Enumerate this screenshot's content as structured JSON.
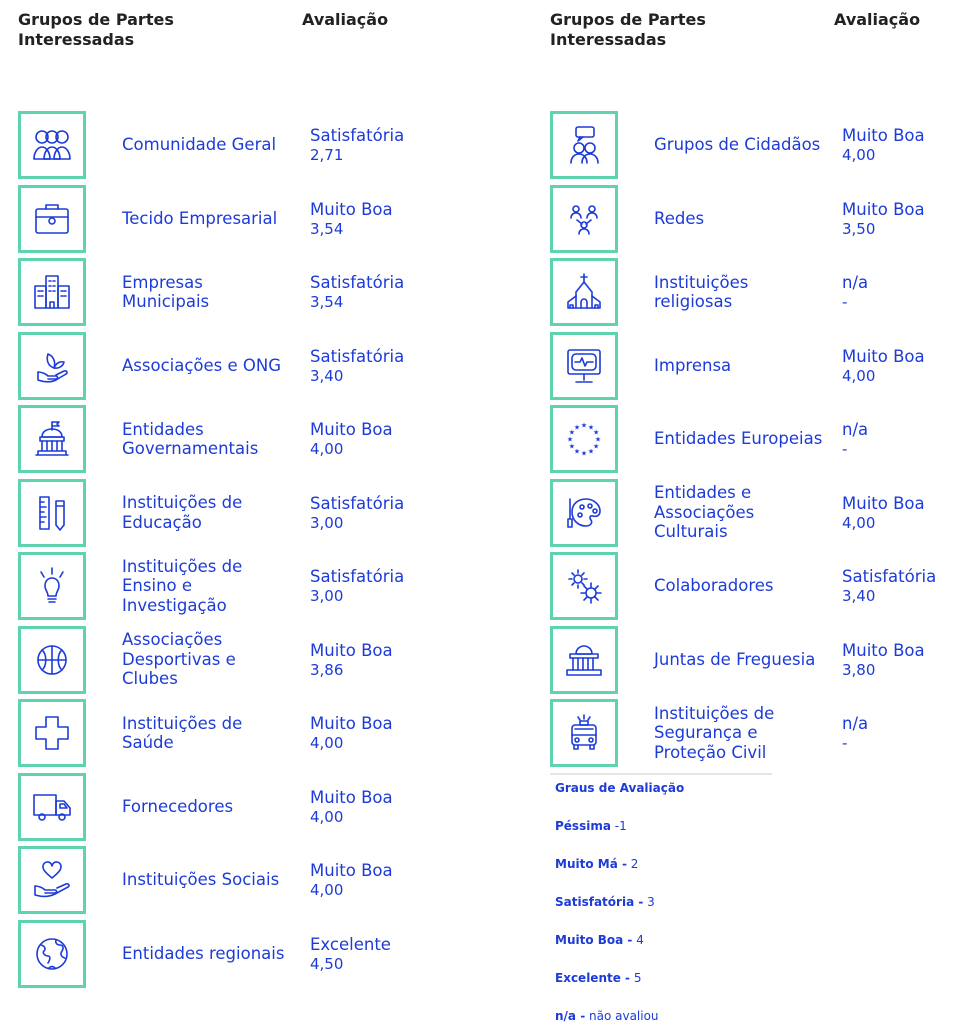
{
  "header": {
    "col1": "Grupos de Partes Interessadas",
    "col2": "Avaliação"
  },
  "left": [
    {
      "icon": "community-icon",
      "name": "Comunidade Geral",
      "rating": "Satisfatória",
      "value": "2,71"
    },
    {
      "icon": "briefcase-icon",
      "name": "Tecido Empresarial",
      "rating": "Muito Boa",
      "value": "3,54"
    },
    {
      "icon": "buildings-icon",
      "name": "Empresas Municipais",
      "rating": "Satisfatória",
      "value": "3,54"
    },
    {
      "icon": "hand-plant-icon",
      "name": "Associações e ONG",
      "rating": "Satisfatória",
      "value": "3,40"
    },
    {
      "icon": "government-building-icon",
      "name": "Entidades Governamentais",
      "rating": "Muito Boa",
      "value": "4,00"
    },
    {
      "icon": "ruler-pencil-icon",
      "name": "Instituições de Educação",
      "rating": "Satisfatória",
      "value": "3,00"
    },
    {
      "icon": "lightbulb-icon",
      "name": "Instituições de Ensino e Investigação",
      "rating": "Satisfatória",
      "value": "3,00"
    },
    {
      "icon": "basketball-icon",
      "name": "Associações Desportivas e Clubes",
      "rating": "Muito Boa",
      "value": "3,86"
    },
    {
      "icon": "health-cross-icon",
      "name": "Instituições de Saúde",
      "rating": "Muito Boa",
      "value": "4,00"
    },
    {
      "icon": "truck-icon",
      "name": "Fornecedores",
      "rating": "Muito Boa",
      "value": "4,00"
    },
    {
      "icon": "hand-heart-icon",
      "name": "Instituições Sociais",
      "rating": "Muito Boa",
      "value": "4,00"
    },
    {
      "icon": "globe-icon",
      "name": "Entidades regionais",
      "rating": "Excelente",
      "value": "4,50"
    }
  ],
  "right": [
    {
      "icon": "chat-people-icon",
      "name": "Grupos de Cidadãos",
      "rating": "Muito Boa",
      "value": "4,00"
    },
    {
      "icon": "network-icon",
      "name": "Redes",
      "rating": "Muito Boa",
      "value": "3,50"
    },
    {
      "icon": "church-icon",
      "name": "Instituições religiosas",
      "rating": "n/a",
      "value": "-"
    },
    {
      "icon": "monitor-icon",
      "name": "Imprensa",
      "rating": "Muito Boa",
      "value": "4,00"
    },
    {
      "icon": "eu-stars-icon",
      "name": "Entidades Europeias",
      "rating": "n/a",
      "value": "-"
    },
    {
      "icon": "palette-icon",
      "name": "Entidades e Associações Culturais",
      "rating": "Muito Boa",
      "value": "4,00"
    },
    {
      "icon": "gears-icon",
      "name": "Colaboradores",
      "rating": "Satisfatória",
      "value": "3,40"
    },
    {
      "icon": "town-hall-icon",
      "name": "Juntas de Freguesia",
      "rating": "Muito Boa",
      "value": "3,80"
    },
    {
      "icon": "fire-truck-icon",
      "name": "Instituições de Segurança e Proteção Civil",
      "rating": "n/a",
      "value": "-"
    }
  ],
  "legend": {
    "title": "Graus de Avaliação",
    "items": [
      {
        "label": "Péssima",
        "rest": " -1"
      },
      {
        "label": "Muito Má -",
        "rest": " 2"
      },
      {
        "label": "Satisfatória -",
        "rest": " 3"
      },
      {
        "label": "Muito Boa -",
        "rest": " 4"
      },
      {
        "label": "Excelente -",
        "rest": " 5"
      },
      {
        "label": "n/a -",
        "rest": " não avaliou"
      }
    ]
  },
  "colors": {
    "accent": "#1d3bd8",
    "border": "#5fd3b0"
  }
}
